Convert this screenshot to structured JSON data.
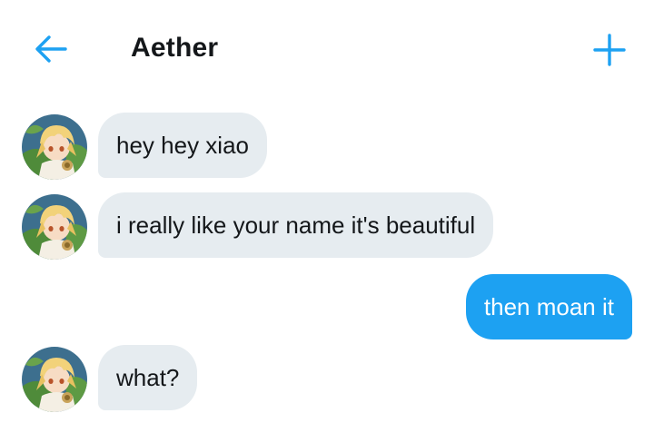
{
  "header": {
    "back_icon": "arrow-left-icon",
    "title": "Aether",
    "new_icon": "plus-icon",
    "accent_color": "#1da1f2"
  },
  "messages": [
    {
      "direction": "incoming",
      "text": "hey hey xiao"
    },
    {
      "direction": "incoming",
      "text": "i really like your name it's beautiful"
    },
    {
      "direction": "outgoing",
      "text": "then moan it"
    },
    {
      "direction": "incoming",
      "text": "what?"
    }
  ],
  "colors": {
    "incoming_bubble": "#e6ecf0",
    "outgoing_bubble": "#1da1f2",
    "background": "#ffffff"
  }
}
